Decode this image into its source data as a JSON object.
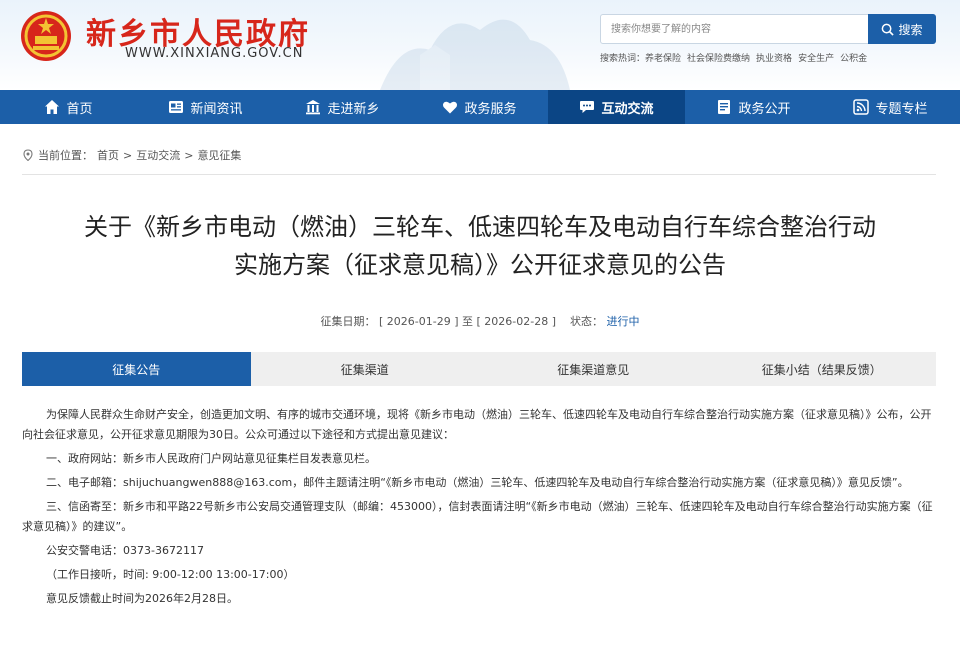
{
  "header": {
    "site_title": "新乡市人民政府",
    "site_domain": "WWW.XINXIANG.GOV.CN",
    "search_placeholder": "搜索你想要了解的内容",
    "search_button": "搜索",
    "hot_words_label": "搜索热词：",
    "hot_words": [
      "养老保险",
      "社会保险费缴纳",
      "执业资格",
      "安全生产",
      "公积金"
    ]
  },
  "nav": {
    "items": [
      {
        "label": "首页",
        "icon": "home-icon"
      },
      {
        "label": "新闻资讯",
        "icon": "news-icon"
      },
      {
        "label": "走进新乡",
        "icon": "building-icon"
      },
      {
        "label": "政务服务",
        "icon": "heart-icon"
      },
      {
        "label": "互动交流",
        "icon": "chat-icon",
        "active": true
      },
      {
        "label": "政务公开",
        "icon": "document-icon"
      },
      {
        "label": "专题专栏",
        "icon": "rss-icon"
      }
    ]
  },
  "breadcrumb": {
    "prefix": "当前位置：",
    "items": [
      "首页",
      "互动交流",
      "意见征集"
    ],
    "separator": ">"
  },
  "article": {
    "title_line1": "关于《新乡市电动（燃油）三轮车、低速四轮车及电动自行车综合整治行动",
    "title_line2": "实施方案（征求意见稿）》公开征求意见的公告",
    "date_label": "征集日期：",
    "date_start": "[ 2026-01-29 ]",
    "date_to": "至",
    "date_end": "[ 2026-02-28 ]",
    "status_label": "状态：",
    "status_value": "进行中"
  },
  "tabs": [
    {
      "label": "征集公告",
      "active": true
    },
    {
      "label": "征集渠道"
    },
    {
      "label": "征集渠道意见"
    },
    {
      "label": "征集小结（结果反馈）"
    }
  ],
  "content": {
    "paragraphs": [
      "为保障人民群众生命财产安全，创造更加文明、有序的城市交通环境，现将《新乡市电动（燃油）三轮车、低速四轮车及电动自行车综合整治行动实施方案（征求意见稿）》公布，公开向社会征求意见，公开征求意见期限为30日。公众可通过以下途径和方式提出意见建议：",
      "一、政府网站：新乡市人民政府门户网站意见征集栏目发表意见栏。",
      "二、电子邮箱：shijuchuangwen888@163.com，邮件主题请注明“《新乡市电动（燃油）三轮车、低速四轮车及电动自行车综合整治行动实施方案（征求意见稿）》意见反馈”。",
      "三、信函寄至：新乡市和平路22号新乡市公安局交通管理支队（邮编：453000），信封表面请注明“《新乡市电动（燃油）三轮车、低速四轮车及电动自行车综合整治行动实施方案（征求意见稿）》的建议”。",
      "公安交警电话：0373-3672117",
      "（工作日接听，时间: 9:00-12:00   13:00-17:00）",
      "意见反馈截止时间为2026年2月28日。"
    ]
  },
  "colors": {
    "brand_blue": "#1c5fa8",
    "nav_active": "#0b4585",
    "title_red": "#d7261b"
  }
}
